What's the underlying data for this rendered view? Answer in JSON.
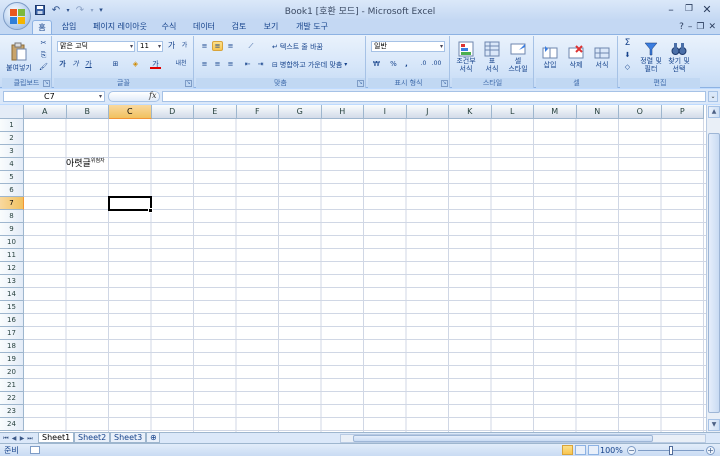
{
  "window": {
    "title": "Book1  [호환 모드] - Microsoft Excel",
    "minimize": "–",
    "restore": "❐",
    "close": "✕"
  },
  "qat": {
    "save_icon": "save-icon",
    "undo_icon": "undo-icon",
    "redo_icon": "redo-icon",
    "undo_glyph": "↶",
    "redo_glyph": "↷",
    "more": "▾"
  },
  "tabs": [
    "홈",
    "삽입",
    "페이지 레이아웃",
    "수식",
    "데이터",
    "검토",
    "보기",
    "개발 도구"
  ],
  "tab_active": 0,
  "tab_right": {
    "help": "?",
    "min": "–",
    "restore": "❐",
    "close": "✕"
  },
  "ribbon": {
    "clipboard": {
      "label": "클립보드",
      "paste": "붙여넣기"
    },
    "font": {
      "label": "글꼴",
      "font_name": "맑은 고딕",
      "font_size": "11",
      "grow": "가",
      "shrink": "가",
      "bold": "가",
      "italic": "가",
      "underline": "가",
      "font_color": "가",
      "phonetic": "내천"
    },
    "alignment": {
      "label": "맞춤",
      "wrap": "텍스트 줄 바꿈",
      "merge": "병합하고 가운데 맞춤"
    },
    "number": {
      "label": "표시 형식",
      "format": "일반",
      "currency": "₩",
      "percent": "%",
      "comma": ","
    },
    "styles": {
      "label": "스타일",
      "conditional": "조건부\n서식",
      "table": "표\n서식",
      "cell_style": "셀\n스타일"
    },
    "cells": {
      "label": "셀",
      "insert": "삽입",
      "delete": "삭제",
      "format": "서식"
    },
    "editing": {
      "label": "편집",
      "sigma": "Σ",
      "sort": "정렬 및\n필터",
      "find": "찾기 및\n선택"
    }
  },
  "formula_bar": {
    "name_box": "C7",
    "fx": "fx",
    "formula": ""
  },
  "grid": {
    "columns": [
      "A",
      "B",
      "C",
      "D",
      "E",
      "F",
      "G",
      "H",
      "I",
      "J",
      "K",
      "L",
      "M",
      "N",
      "O",
      "P"
    ],
    "selected_column": "C",
    "rows": [
      "1",
      "2",
      "3",
      "4",
      "5",
      "6",
      "7",
      "8",
      "9",
      "10",
      "11",
      "12",
      "13",
      "14",
      "15",
      "16",
      "17",
      "18",
      "19",
      "20",
      "21",
      "22",
      "23",
      "24"
    ],
    "selected_row": "7",
    "cell_B4": {
      "base": "아렷글",
      "ruby": "위첨자"
    }
  },
  "sheets": {
    "tabs": [
      "Sheet1",
      "Sheet2",
      "Sheet3"
    ],
    "active": "Sheet1",
    "nav": [
      "⏮",
      "◀",
      "▶",
      "⏭"
    ]
  },
  "status": {
    "text": "준비",
    "zoom": "100%",
    "zoom_level_percent": 50
  }
}
